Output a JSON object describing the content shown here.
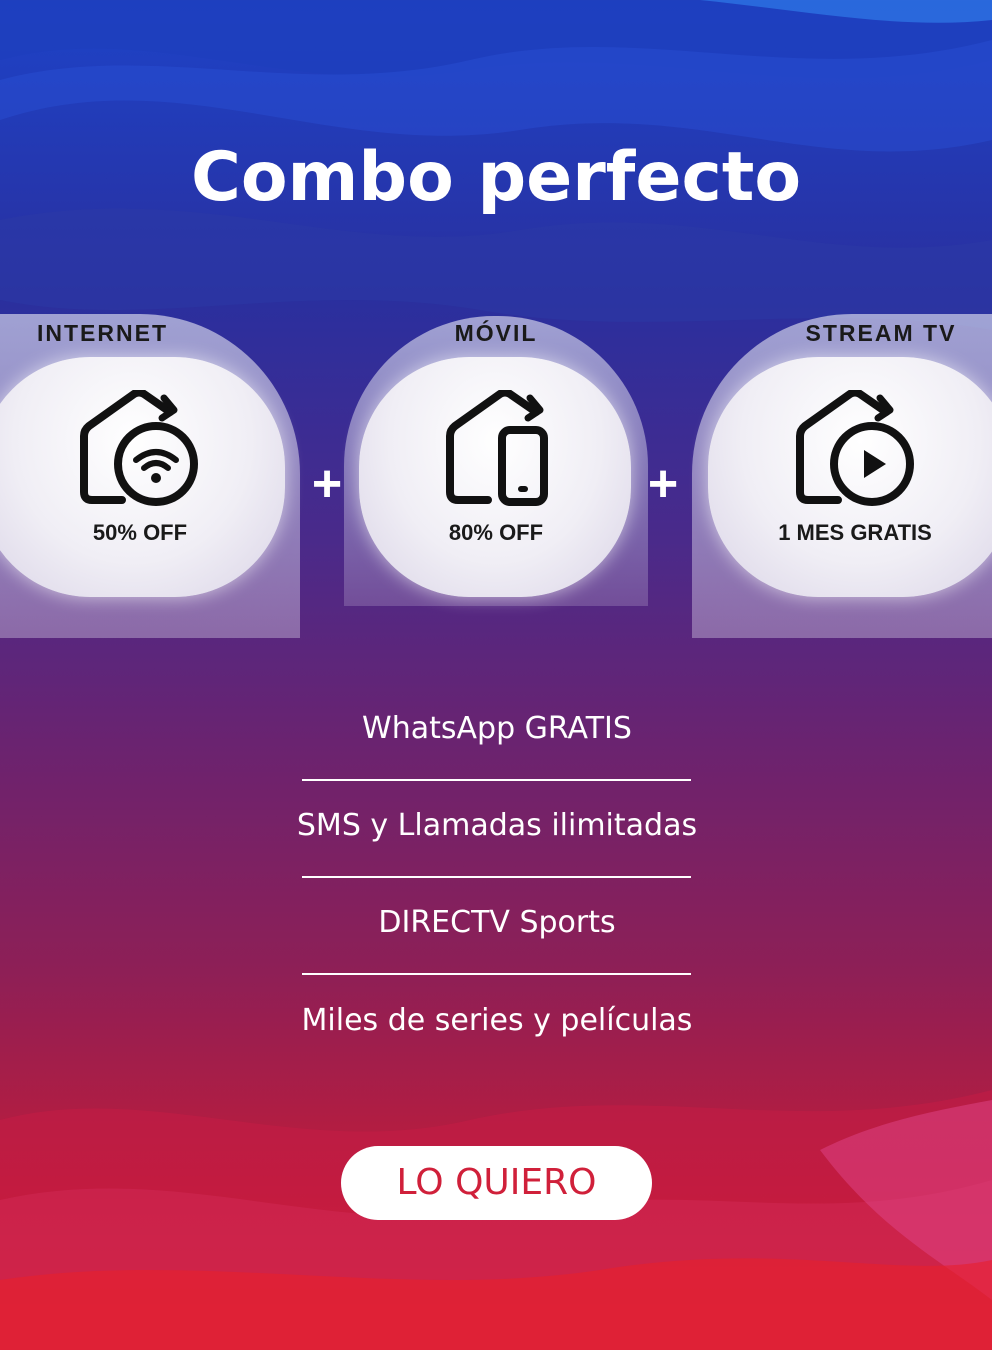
{
  "title": "Combo perfecto",
  "products": [
    {
      "label": "INTERNET",
      "offer": "50% OFF",
      "icon": "home-wifi-icon"
    },
    {
      "label": "MÓVIL",
      "offer": "80% OFF",
      "icon": "home-phone-icon"
    },
    {
      "label": "STREAM TV",
      "offer": "1 MES GRATIS",
      "icon": "home-play-icon"
    }
  ],
  "plus_symbol": "+",
  "features": [
    "WhatsApp GRATIS",
    "SMS y Llamadas ilimitadas",
    "DIRECTV Sports",
    "Miles de series y películas"
  ],
  "cta_label": "LO QUIERO",
  "colors": {
    "background_top": "#1d43c8",
    "background_bottom": "#e81f2b",
    "cta_text": "#d0203a",
    "card_text": "#1a1a1a"
  }
}
